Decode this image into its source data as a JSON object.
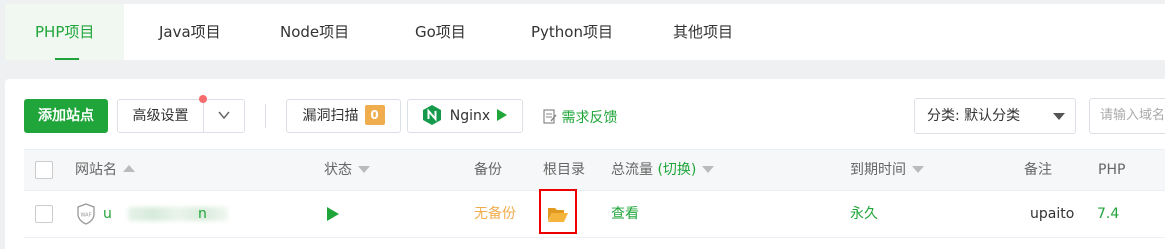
{
  "tabs": [
    {
      "label": "PHP项目",
      "active": true
    },
    {
      "label": "Java项目"
    },
    {
      "label": "Node项目"
    },
    {
      "label": "Go项目"
    },
    {
      "label": "Python项目"
    },
    {
      "label": "其他项目"
    }
  ],
  "toolbar": {
    "add_site": "添加站点",
    "advanced": "高级设置",
    "vuln_scan": "漏洞扫描",
    "vuln_count": "0",
    "nginx": "Nginx",
    "feedback": "需求反馈",
    "category": "分类: 默认分类",
    "search_placeholder": "请输入域名"
  },
  "table": {
    "headers": {
      "name": "网站名",
      "status": "状态",
      "backup": "备份",
      "root": "根目录",
      "traffic": "总流量",
      "traffic_toggle": "(切换)",
      "expire": "到期时间",
      "remark": "备注",
      "php": "PHP"
    },
    "rows": [
      {
        "name_visible_start": "u",
        "name_visible_end": "n",
        "backup": "无备份",
        "traffic": "查看",
        "expire": "永久",
        "remark": "upaito",
        "php": "7.4"
      }
    ]
  },
  "colors": {
    "accent": "#20a53a",
    "warning": "#f0ad4e",
    "highlight": "#e00000",
    "badge_dot": "#f56c6c"
  },
  "icons": [
    "chevron-down-icon",
    "nginx-icon",
    "play-icon",
    "edit-note-icon",
    "caret-down-icon",
    "sort-asc-icon",
    "sort-desc-icon",
    "waf-shield-icon",
    "folder-open-icon"
  ]
}
